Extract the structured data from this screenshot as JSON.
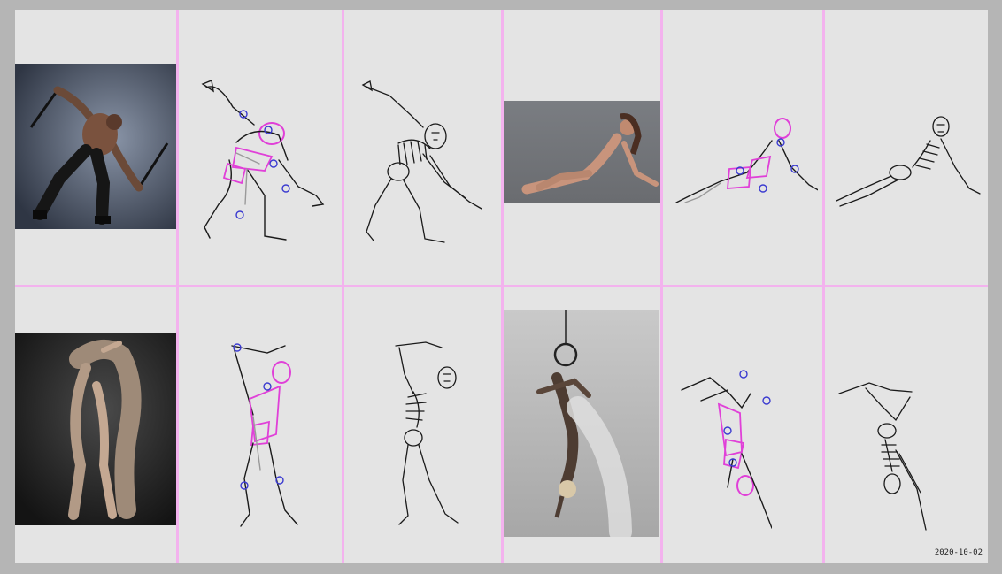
{
  "sheet": {
    "date_stamp": "2020-10-02",
    "colors": {
      "background": "#b5b5b5",
      "paper": "#e4e4e4",
      "grid_line": "#f3b2ee",
      "ink": "#1a1a1a",
      "guide_magenta": "#e040d8",
      "guide_blue": "#3a3ad0",
      "guide_gray": "#9a9a9a"
    }
  },
  "rows": [
    {
      "photos": [
        {
          "subject": "man-with-two-swords-lunging"
        },
        {
          "subject": "woman-reclining-on-floor"
        }
      ],
      "studies": [
        "mannequin-study",
        "skeleton-study",
        "mannequin-study",
        "skeleton-study"
      ]
    },
    {
      "photos": [
        {
          "subject": "dancer-with-draped-fabric"
        },
        {
          "subject": "aerial-hoop-performer-inverted"
        }
      ],
      "studies": [
        "mannequin-study",
        "skeleton-study",
        "mannequin-study",
        "skeleton-study"
      ]
    }
  ]
}
